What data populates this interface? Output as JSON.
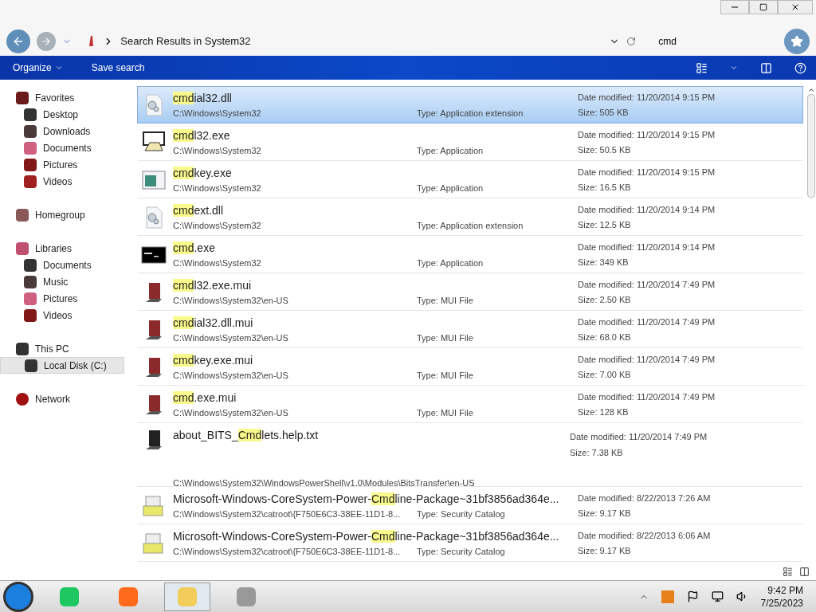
{
  "address_bar": {
    "location": "Search Results in System32"
  },
  "search": {
    "value": "cmd"
  },
  "toolbar": {
    "items": [
      "Organize",
      "Save search"
    ]
  },
  "sidebar": {
    "groups": [
      {
        "label": "Favorites",
        "selected": false,
        "children": [
          {
            "label": "Desktop",
            "selected": false
          },
          {
            "label": "Downloads",
            "selected": false
          },
          {
            "label": "Documents",
            "selected": false
          },
          {
            "label": "Pictures",
            "selected": false
          },
          {
            "label": "Videos",
            "selected": false
          }
        ]
      },
      {
        "label": "Homegroup",
        "selected": false
      },
      {
        "label": "Libraries",
        "selected": false,
        "children": [
          {
            "label": "Documents",
            "selected": false
          },
          {
            "label": "Music",
            "selected": false
          },
          {
            "label": "Pictures",
            "selected": false
          },
          {
            "label": "Videos",
            "selected": false
          }
        ]
      },
      {
        "label": "This PC",
        "selected": false,
        "children": [
          {
            "label": "Local Disk (C:)",
            "selected": true
          }
        ]
      },
      {
        "label": "Network",
        "selected": false
      }
    ]
  },
  "results": [
    {
      "kind": "compact",
      "selected": true,
      "name": {
        "match": "cmd",
        "after": "ial32.dll"
      },
      "path": "C:\\Windows\\System32",
      "type": "Type: Application extension",
      "date": "Date modified: 11/20/2014 9:15 PM",
      "size": "Size: 505 KB"
    },
    {
      "kind": "compact",
      "selected": false,
      "name": {
        "match": "cmd",
        "after": "l32.exe"
      },
      "path": "C:\\Windows\\System32",
      "type": "Type: Application",
      "date": "Date modified: 11/20/2014 9:15 PM",
      "size": "Size: 50.5 KB"
    },
    {
      "kind": "compact",
      "selected": false,
      "name": {
        "match": "cmd",
        "after": "key.exe"
      },
      "path": "C:\\Windows\\System32",
      "type": "Type: Application",
      "date": "Date modified: 11/20/2014 9:15 PM",
      "size": "Size: 16.5 KB"
    },
    {
      "kind": "compact",
      "selected": false,
      "name": {
        "match": "cmd",
        "after": "ext.dll"
      },
      "path": "C:\\Windows\\System32",
      "type": "Type: Application extension",
      "date": "Date modified: 11/20/2014 9:14 PM",
      "size": "Size: 12.5 KB"
    },
    {
      "kind": "compact",
      "selected": false,
      "name": {
        "match": "cmd",
        "after": ".exe"
      },
      "path": "C:\\Windows\\System32",
      "type": "Type: Application",
      "date": "Date modified: 11/20/2014 9:14 PM",
      "size": "Size: 349 KB"
    },
    {
      "kind": "compact",
      "selected": false,
      "name": {
        "match": "cmd",
        "after": "l32.exe.mui"
      },
      "path": "C:\\Windows\\System32\\en-US",
      "type": "Type: MUI File",
      "date": "Date modified: 11/20/2014 7:49 PM",
      "size": "Size: 2.50 KB"
    },
    {
      "kind": "compact",
      "selected": false,
      "name": {
        "match": "cmd",
        "after": "ial32.dll.mui"
      },
      "path": "C:\\Windows\\System32\\en-US",
      "type": "Type: MUI File",
      "date": "Date modified: 11/20/2014 7:49 PM",
      "size": "Size: 68.0 KB"
    },
    {
      "kind": "compact",
      "selected": false,
      "name": {
        "match": "cmd",
        "after": "key.exe.mui"
      },
      "path": "C:\\Windows\\System32\\en-US",
      "type": "Type: MUI File",
      "date": "Date modified: 11/20/2014 7:49 PM",
      "size": "Size: 7.00 KB"
    },
    {
      "kind": "compact",
      "selected": false,
      "name": {
        "match": "cmd",
        "after": ".exe.mui"
      },
      "path": "C:\\Windows\\System32\\en-US",
      "type": "Type: MUI File",
      "date": "Date modified: 11/20/2014 7:49 PM",
      "size": "Size: 128 KB"
    },
    {
      "kind": "tall",
      "selected": false,
      "name": {
        "before": "about_BITS_",
        "match": "Cmd",
        "after": "lets.help.txt"
      },
      "path": "C:\\Windows\\System32\\WindowsPowerShell\\v1.0\\Modules\\BitsTransfer\\en-US",
      "date": "Date modified: 11/20/2014 7:49 PM",
      "size": "Size: 7.38 KB"
    },
    {
      "kind": "compact",
      "selected": false,
      "name": {
        "before": "Microsoft-Windows-CoreSystem-Power-",
        "match": "Cmd",
        "after": "line-Package~31bf3856ad364e..."
      },
      "path": "C:\\Windows\\System32\\catroot\\{F750E6C3-38EE-11D1-8...",
      "type": "Type: Security Catalog",
      "date": "Date modified: 8/22/2013 7:26 AM",
      "size": "Size: 9.17 KB"
    },
    {
      "kind": "compact",
      "selected": false,
      "name": {
        "before": "Microsoft-Windows-CoreSystem-Power-",
        "match": "Cmd",
        "after": "line-Package~31bf3856ad364e..."
      },
      "path": "C:\\Windows\\System32\\catroot\\{F750E6C3-38EE-11D1-8...",
      "type": "Type: Security Catalog",
      "date": "Date modified: 8/22/2013 6:06 AM",
      "size": "Size: 9.17 KB"
    }
  ],
  "taskbar": {
    "apps": [
      {
        "selected": false
      },
      {
        "selected": false
      },
      {
        "selected": true
      },
      {
        "selected": false
      }
    ],
    "time": "9:42 PM",
    "date": "7/25/2023"
  }
}
